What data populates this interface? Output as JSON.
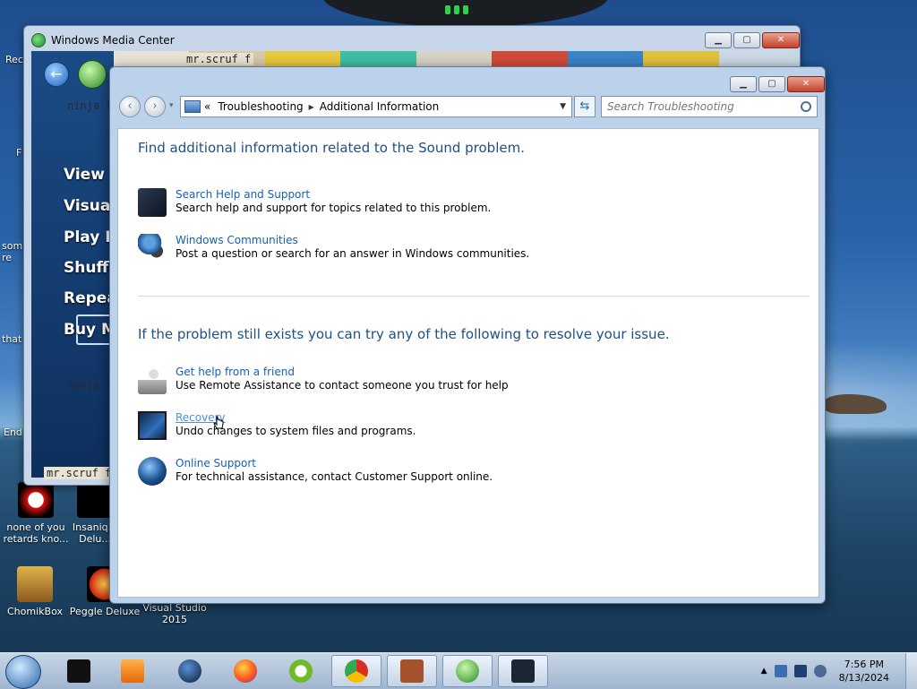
{
  "desktop": {
    "icons": [
      {
        "label": "none of you retards kno...",
        "icon": "red-app-icon"
      },
      {
        "label": "Insaniq... Delu...",
        "icon": "app-icon"
      },
      {
        "label": "ChomikBox",
        "icon": "chomikbox-icon"
      },
      {
        "label": "Peggle Deluxe",
        "icon": "peggle-icon"
      },
      {
        "label": "Visual Studio 2015",
        "icon": "visual-studio-icon"
      }
    ],
    "cut_labels": [
      "Rec",
      "F",
      "som re",
      "that",
      "End"
    ]
  },
  "wmc": {
    "title": "Windows Media Center",
    "menu": [
      "View Sc",
      "Visualiz",
      "Play Pic",
      "Shuffle",
      "Repeat",
      "Buy Mu"
    ],
    "art_top": "mr.scruf f",
    "art_bottom": "mr.scruf f",
    "ninja": "ninja tune"
  },
  "ts_window": {
    "address": {
      "prefix": "«",
      "crumbs": [
        "Troubleshooting",
        "Additional Information"
      ]
    },
    "search_placeholder": "Search Troubleshooting",
    "section1": {
      "heading": "Find additional information related to the Sound problem.",
      "items": [
        {
          "title": "Search Help and Support",
          "desc": "Search help and support for topics related to this problem.",
          "icon": "help-support-icon"
        },
        {
          "title": "Windows Communities",
          "desc": "Post a question or search for an answer in Windows communities.",
          "icon": "communities-icon"
        }
      ]
    },
    "section2": {
      "heading": "If the problem still exists you can try any of the following to resolve your issue.",
      "items": [
        {
          "title": "Get help from a friend",
          "desc": "Use Remote Assistance to contact someone you trust for help",
          "icon": "remote-assistance-icon"
        },
        {
          "title": "Recovery",
          "desc": "Undo changes to system files and programs.",
          "icon": "recovery-icon"
        },
        {
          "title": "Online Support",
          "desc": "For technical assistance, contact Customer Support online.",
          "icon": "online-support-icon"
        }
      ]
    }
  },
  "taskbar": {
    "items": [
      "start-orb",
      "app-black",
      "media-player-icon",
      "globe-icon",
      "firefox-icon",
      "app-green-icon",
      "chrome-icon",
      "firewall-icon",
      "media-center-icon",
      "troubleshooting-icon"
    ],
    "clock_time": "7:56 PM",
    "clock_date": "8/13/2024"
  }
}
